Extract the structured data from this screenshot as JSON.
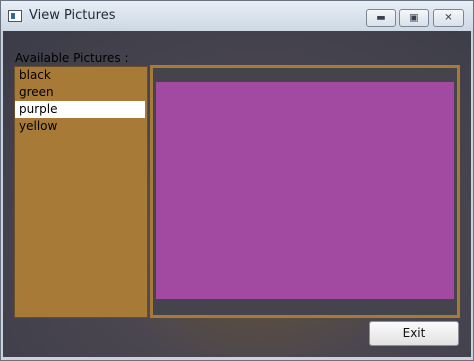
{
  "window": {
    "title": "View Pictures"
  },
  "list": {
    "label": "Available Pictures :",
    "items": [
      "black",
      "green",
      "purple",
      "yellow"
    ],
    "selected_index": 2
  },
  "preview": {
    "color": "#a24aa1"
  },
  "buttons": {
    "exit_label": "Exit"
  }
}
